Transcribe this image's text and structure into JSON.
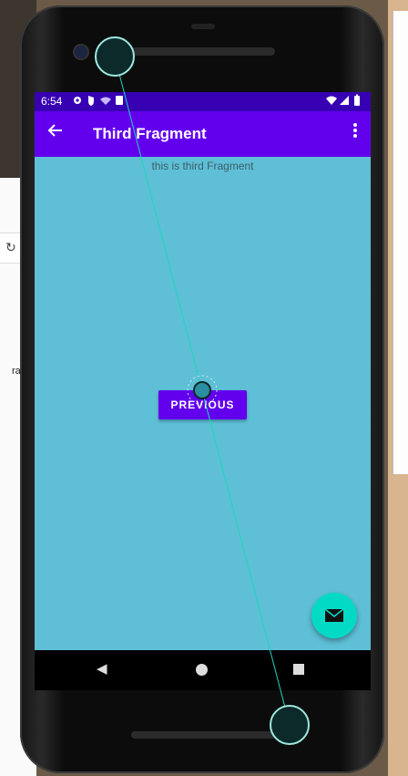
{
  "status_bar": {
    "time": "6:54"
  },
  "app_bar": {
    "title": "Third Fragment"
  },
  "content": {
    "fragment_text": "this is third Fragment",
    "previous_button": "PREVIOUS"
  },
  "background": {
    "left_text": "ra"
  },
  "colors": {
    "status_bar": "#3700b3",
    "app_bar": "#6200ee",
    "screen_bg": "#5ebfd6",
    "button": "#6200ee",
    "fab": "#03dac5"
  },
  "icons": {
    "back": "arrow-left-icon",
    "menu": "overflow-menu-icon",
    "fab": "mail-icon",
    "nav_back": "triangle-back-icon",
    "nav_home": "circle-home-icon",
    "nav_recents": "square-recents-icon"
  }
}
